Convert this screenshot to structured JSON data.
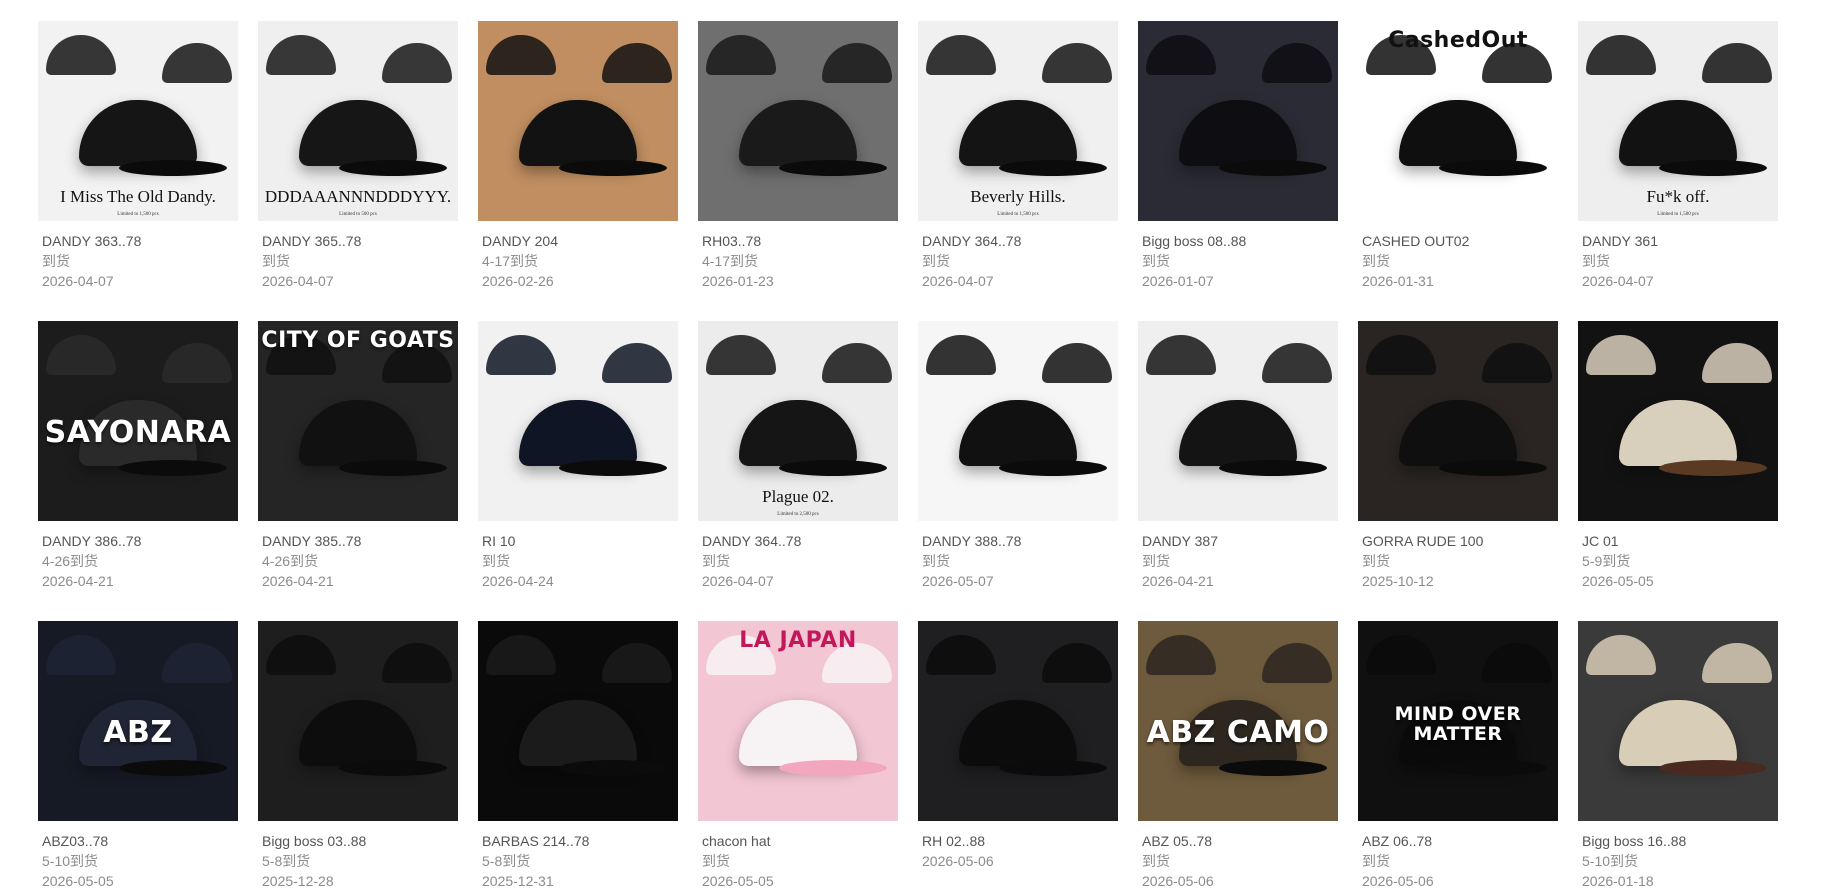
{
  "products": [
    {
      "name": "DANDY 363..78",
      "status": "到货",
      "date": "2026-04-07",
      "image": {
        "bg": "#f2f2f2",
        "cap": "#151515",
        "headline": "",
        "caption": "I Miss The Old Dandy.",
        "caption_sub": "Limited to 1,500 pcs"
      }
    },
    {
      "name": "DANDY 365..78",
      "status": "到货",
      "date": "2026-04-07",
      "image": {
        "bg": "#efefef",
        "cap": "#161616",
        "headline": "",
        "caption": "DDDAAANNNDDDYYY.",
        "caption_sub": "Limited to 500 pcs"
      }
    },
    {
      "name": "DANDY 204",
      "status": "4-17到货",
      "date": "2026-02-26",
      "image": {
        "bg": "#c08e60",
        "cap": "#121212",
        "headline": "",
        "caption": "",
        "caption_sub": ""
      }
    },
    {
      "name": "RH03..78",
      "status": "4-17到货",
      "date": "2026-01-23",
      "image": {
        "bg": "#6f6f6f",
        "cap": "#1a1a1a",
        "headline": "",
        "caption": "",
        "caption_sub": ""
      }
    },
    {
      "name": "DANDY 364..78",
      "status": "到货",
      "date": "2026-04-07",
      "image": {
        "bg": "#f0f0f0",
        "cap": "#141414",
        "headline": "",
        "caption": "Beverly Hills.",
        "caption_sub": "Limited to 1,500 pcs"
      }
    },
    {
      "name": "Bigg boss 08..88",
      "status": "到货",
      "date": "2026-01-07",
      "image": {
        "bg": "#2b2b35",
        "cap": "#0d0d12",
        "headline": "",
        "caption": "",
        "caption_sub": ""
      }
    },
    {
      "name": "CASHED OUT02",
      "status": "到货",
      "date": "2026-01-31",
      "image": {
        "bg": "#ffffff",
        "cap": "#0f0f0f",
        "headline": "CashedOut",
        "caption": "",
        "caption_sub": ""
      }
    },
    {
      "name": "DANDY 361",
      "status": "到货",
      "date": "2026-04-07",
      "image": {
        "bg": "#eeeeee",
        "cap": "#121212",
        "headline": "",
        "caption": "Fu*k off.",
        "caption_sub": "Limited to 1,500 pcs"
      }
    },
    {
      "name": "DANDY 386..78",
      "status": "4-26到货",
      "date": "2026-04-21",
      "image": {
        "bg": "#1c1c1c",
        "cap": "#2a2a2a",
        "headline": "SAYONARA",
        "caption": "",
        "caption_sub": ""
      }
    },
    {
      "name": "DANDY 385..78",
      "status": "4-26到货",
      "date": "2026-04-21",
      "image": {
        "bg": "#252525",
        "cap": "#111111",
        "headline": "CITY OF GOATS",
        "caption": "",
        "caption_sub": ""
      }
    },
    {
      "name": "RI 10",
      "status": "到货",
      "date": "2026-04-24",
      "image": {
        "bg": "#f1f1f1",
        "cap": "#0f1524",
        "headline": "",
        "caption": "",
        "caption_sub": ""
      }
    },
    {
      "name": "DANDY 364..78",
      "status": "到货",
      "date": "2026-04-07",
      "image": {
        "bg": "#ececec",
        "cap": "#151515",
        "headline": "",
        "caption": "Plague 02.",
        "caption_sub": "Limited to 2,500 pcs"
      }
    },
    {
      "name": "DANDY 388..78",
      "status": "到货",
      "date": "2026-05-07",
      "image": {
        "bg": "#f6f6f6",
        "cap": "#111111",
        "headline": "",
        "caption": "",
        "caption_sub": ""
      }
    },
    {
      "name": "DANDY 387",
      "status": "到货",
      "date": "2026-04-21",
      "image": {
        "bg": "#efefef",
        "cap": "#141414",
        "headline": "",
        "caption": "",
        "caption_sub": ""
      }
    },
    {
      "name": "GORRA RUDE 100",
      "status": "到货",
      "date": "2025-10-12",
      "image": {
        "bg": "#2a2522",
        "cap": "#0f0f0f",
        "headline": "",
        "caption": "",
        "caption_sub": ""
      }
    },
    {
      "name": "JC 01",
      "status": "5-9到货",
      "date": "2026-05-05",
      "image": {
        "bg": "#121212",
        "cap": "#d9cfbd",
        "brim": "#5a3a22",
        "headline": "",
        "caption": "",
        "caption_sub": ""
      }
    },
    {
      "name": "ABZ03..78",
      "status": "5-10到货",
      "date": "2026-05-05",
      "image": {
        "bg": "#161a24",
        "cap": "#1f2535",
        "headline": "ABZ",
        "caption": "",
        "caption_sub": ""
      }
    },
    {
      "name": "Bigg boss 03..88",
      "status": "5-8到货",
      "date": "2025-12-28",
      "image": {
        "bg": "#1e1e1e",
        "cap": "#0d0d0d",
        "headline": "",
        "caption": "",
        "caption_sub": ""
      }
    },
    {
      "name": "BARBAS 214..78",
      "status": "5-8到货",
      "date": "2025-12-31",
      "image": {
        "bg": "#0a0a0a",
        "cap": "#1b1b1b",
        "headline": "",
        "caption": "",
        "caption_sub": ""
      }
    },
    {
      "name": "chacon hat",
      "status": "到货",
      "date": "2026-05-05",
      "image": {
        "bg": "#f3c6d4",
        "cap": "#f7f3f4",
        "brim": "#f3a7bf",
        "headline": "LA JAPAN",
        "caption": "",
        "caption_sub": ""
      }
    },
    {
      "name": "RH 02..88",
      "status": "",
      "date": "2026-05-06",
      "image": {
        "bg": "#1f1f22",
        "cap": "#0c0c0c",
        "headline": "",
        "caption": "",
        "caption_sub": ""
      }
    },
    {
      "name": "ABZ 05..78",
      "status": "到货",
      "date": "2026-05-06",
      "image": {
        "bg": "#6e5a3c",
        "cap": "#2d2720",
        "headline": "ABZ CAMO",
        "caption": "",
        "caption_sub": ""
      }
    },
    {
      "name": "ABZ 06..78",
      "status": "到货",
      "date": "2026-05-06",
      "image": {
        "bg": "#101010",
        "cap": "#0a0a0a",
        "headline": "MIND OVER MATTER",
        "caption": "",
        "caption_sub": ""
      }
    },
    {
      "name": "Bigg boss 16..88",
      "status": "5-10到货",
      "date": "2026-01-18",
      "image": {
        "bg": "#3a3a3a",
        "cap": "#d8cdb6",
        "brim": "#4a2a20",
        "headline": "",
        "caption": "",
        "caption_sub": ""
      }
    }
  ],
  "colors": {
    "name_text": "#555555",
    "meta_text": "#8c8c8c",
    "page_bg": "#ffffff"
  }
}
